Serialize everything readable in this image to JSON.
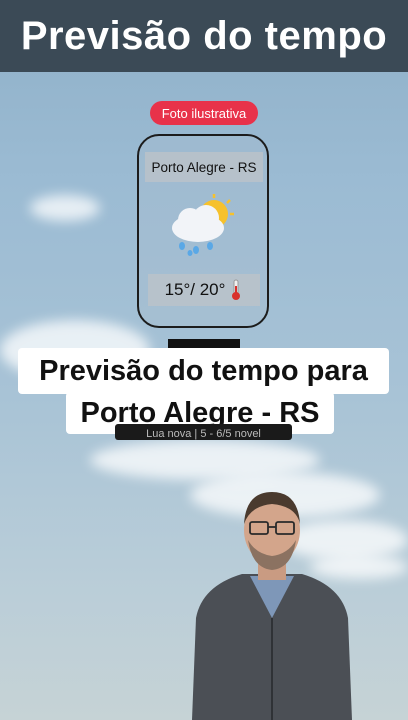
{
  "header": {
    "title": "Previsão do tempo"
  },
  "badge": {
    "label": "Foto ilustrativa"
  },
  "card": {
    "city": "Porto Alegre - RS",
    "temperature": "15°/ 20°",
    "weather_icon": "cloud-rain-sun-icon",
    "temperature_icon": "thermometer-icon"
  },
  "caption": {
    "line1": "Previsão do tempo para",
    "line2": "Porto Alegre - RS"
  },
  "ticker": {
    "text": "Lua nova | 5 - 6/5 novel"
  },
  "colors": {
    "header_bg": "#3b4a56",
    "badge_bg": "#e8324a",
    "caption_bg": "#ffffff"
  }
}
